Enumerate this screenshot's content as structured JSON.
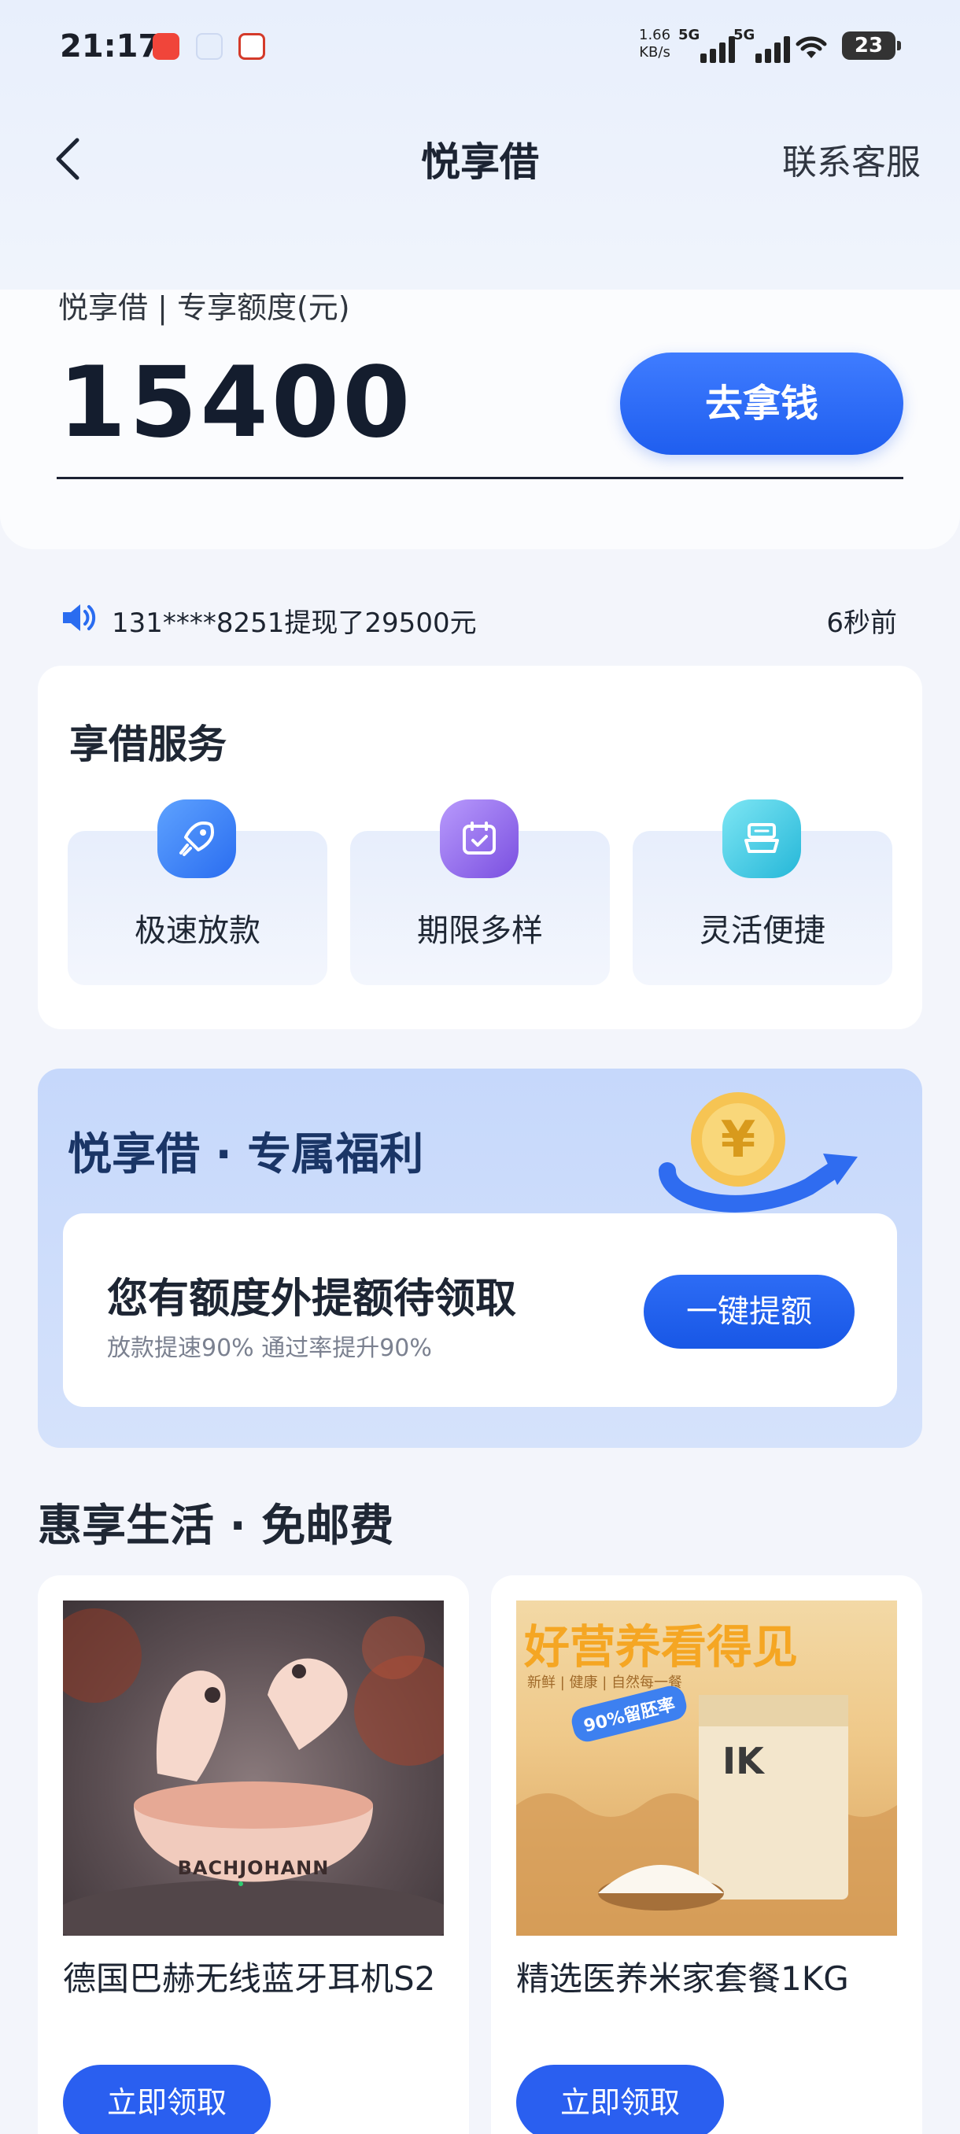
{
  "status_bar": {
    "time": "21:17",
    "net_speed_value": "1.66",
    "net_speed_unit": "KB/s",
    "signal1_label": "5G",
    "signal2_label": "5G",
    "battery": "23"
  },
  "header": {
    "title": "悦享借",
    "contact": "联系客服"
  },
  "credit": {
    "label": "悦享借 | 专享额度(元)",
    "amount": "15400",
    "button": "去拿钱"
  },
  "notice": {
    "text": "131****8251提现了29500元",
    "time": "6秒前"
  },
  "services": {
    "title": "享借服务",
    "items": [
      {
        "label": "极速放款",
        "icon": "rocket-icon"
      },
      {
        "label": "期限多样",
        "icon": "calendar-icon"
      },
      {
        "label": "灵活便捷",
        "icon": "stack-icon"
      }
    ]
  },
  "benefits": {
    "title": "悦享借 · 专属福利",
    "offer_title": "您有额度外提额待领取",
    "offer_sub": "放款提速90% 通过率提升90%",
    "button": "一键提额"
  },
  "life": {
    "title": "惠享生活 · 免邮费",
    "products": [
      {
        "name": "德国巴赫无线蓝牙耳机S2",
        "button": "立即领取",
        "image_brand": "BACHJOHANN"
      },
      {
        "name": "精选医养米家套餐1KG",
        "button": "立即领取",
        "image_headline": "好营养看得见",
        "image_tagline": "新鲜 | 健康 | 自然每一餐",
        "image_badge": "90%留胚率"
      }
    ]
  },
  "colors": {
    "primary": "#2a5ff0",
    "benefit_bg": "#c6d8fb",
    "page_bg": "#f3f5fb"
  }
}
